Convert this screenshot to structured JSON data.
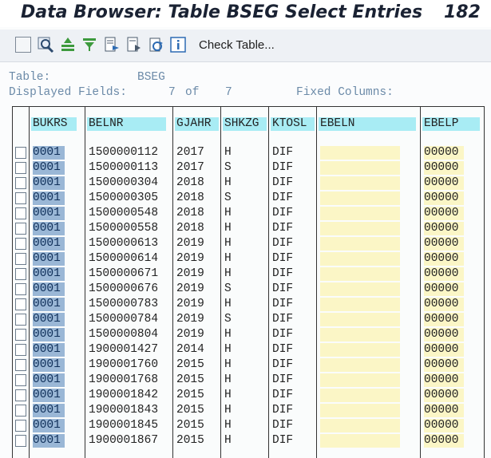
{
  "window": {
    "title": "Data Browser: Table BSEG Select Entries",
    "count": "182"
  },
  "toolbar": {
    "check_table_label": "Check Table..."
  },
  "info": {
    "table_label": "Table:",
    "table_value": "BSEG",
    "displayed_fields_label": "Displayed Fields:",
    "displayed_fields_value": "7",
    "of_label": "of",
    "total_fields": "7",
    "fixed_columns_label": "Fixed Columns:"
  },
  "columns": [
    "BUKRS",
    "BELNR",
    "GJAHR",
    "SHKZG",
    "KTOSL",
    "EBELN",
    "EBELP"
  ],
  "rows": [
    [
      "0001",
      "1500000112",
      "2017",
      "H",
      "DIF",
      "",
      "00000"
    ],
    [
      "0001",
      "1500000113",
      "2017",
      "S",
      "DIF",
      "",
      "00000"
    ],
    [
      "0001",
      "1500000304",
      "2018",
      "H",
      "DIF",
      "",
      "00000"
    ],
    [
      "0001",
      "1500000305",
      "2018",
      "S",
      "DIF",
      "",
      "00000"
    ],
    [
      "0001",
      "1500000548",
      "2018",
      "H",
      "DIF",
      "",
      "00000"
    ],
    [
      "0001",
      "1500000558",
      "2018",
      "H",
      "DIF",
      "",
      "00000"
    ],
    [
      "0001",
      "1500000613",
      "2019",
      "H",
      "DIF",
      "",
      "00000"
    ],
    [
      "0001",
      "1500000614",
      "2019",
      "H",
      "DIF",
      "",
      "00000"
    ],
    [
      "0001",
      "1500000671",
      "2019",
      "H",
      "DIF",
      "",
      "00000"
    ],
    [
      "0001",
      "1500000676",
      "2019",
      "S",
      "DIF",
      "",
      "00000"
    ],
    [
      "0001",
      "1500000783",
      "2019",
      "H",
      "DIF",
      "",
      "00000"
    ],
    [
      "0001",
      "1500000784",
      "2019",
      "S",
      "DIF",
      "",
      "00000"
    ],
    [
      "0001",
      "1500000804",
      "2019",
      "H",
      "DIF",
      "",
      "00000"
    ],
    [
      "0001",
      "1900001427",
      "2014",
      "H",
      "DIF",
      "",
      "00000"
    ],
    [
      "0001",
      "1900001760",
      "2015",
      "H",
      "DIF",
      "",
      "00000"
    ],
    [
      "0001",
      "1900001768",
      "2015",
      "H",
      "DIF",
      "",
      "00000"
    ],
    [
      "0001",
      "1900001842",
      "2015",
      "H",
      "DIF",
      "",
      "00000"
    ],
    [
      "0001",
      "1900001843",
      "2015",
      "H",
      "DIF",
      "",
      "00000"
    ],
    [
      "0001",
      "1900001845",
      "2015",
      "H",
      "DIF",
      "",
      "00000"
    ],
    [
      "0001",
      "1900001867",
      "2015",
      "H",
      "DIF",
      "",
      "00000"
    ]
  ],
  "colors": {
    "header_bg": "#a8ecf4",
    "key_col_bg": "#9ab7d6",
    "input_bg": "#fbf6c6",
    "info_text": "#6b8aa8"
  }
}
